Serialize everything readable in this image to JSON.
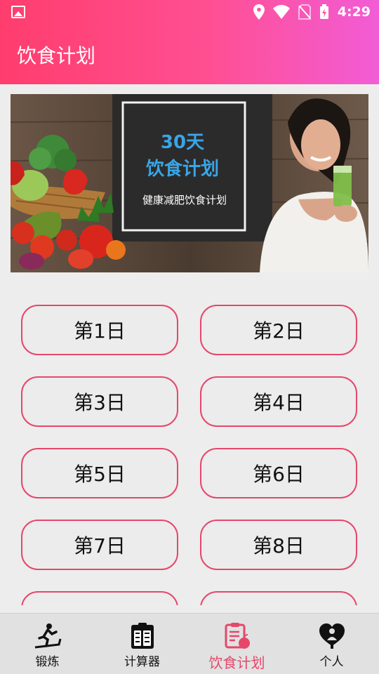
{
  "status": {
    "time": "4:29"
  },
  "app": {
    "title": "饮食计划"
  },
  "banner": {
    "title_line1": "30天",
    "title_line2": "饮食计划",
    "subtitle": "健康减肥饮食计划"
  },
  "days": [
    "第1日",
    "第2日",
    "第3日",
    "第4日",
    "第5日",
    "第6日",
    "第7日",
    "第8日",
    "",
    ""
  ],
  "nav": [
    {
      "label": "锻炼",
      "icon": "treadmill-icon",
      "active": false
    },
    {
      "label": "计算器",
      "icon": "calculator-icon",
      "active": false
    },
    {
      "label": "饮食计划",
      "icon": "diet-plan-icon",
      "active": true
    },
    {
      "label": "个人",
      "icon": "heart-person-icon",
      "active": false
    }
  ],
  "colors": {
    "accent": "#e5476b",
    "gradient_start": "#ff3d6d",
    "gradient_end": "#f25cd6",
    "banner_title": "#3aa5e6"
  }
}
